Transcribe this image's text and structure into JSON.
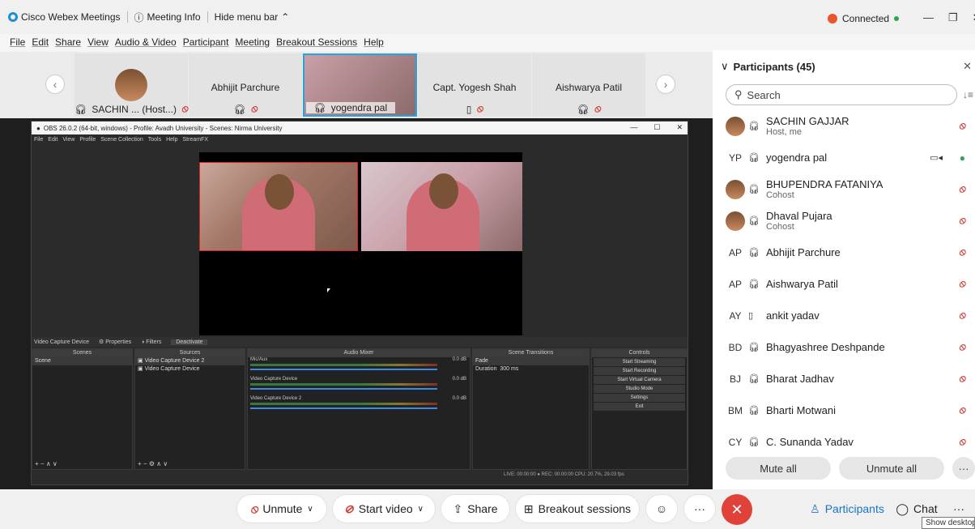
{
  "app": {
    "title": "Cisco Webex Meetings",
    "meeting_info": "Meeting Info",
    "hide_menu": "Hide menu bar",
    "connected": "Connected"
  },
  "menu": [
    "File",
    "Edit",
    "Share",
    "View",
    "Audio & Video",
    "Participant",
    "Meeting",
    "Breakout Sessions",
    "Help"
  ],
  "strip": {
    "tiles": [
      {
        "name": "SACHIN ... (Host...)"
      },
      {
        "name": "Abhijit Parchure"
      },
      {
        "name": "yogendra pal"
      },
      {
        "name": "Capt. Yogesh Shah"
      },
      {
        "name": "Aishwarya Patil"
      }
    ]
  },
  "obs": {
    "title": "OBS 26.0.2 (64-bit, windows) - Profile: Avadh University - Scenes: Nirma University",
    "menu": [
      "File",
      "Edit",
      "View",
      "Profile",
      "Scene Collection",
      "Tools",
      "Help",
      "StreamFX"
    ],
    "bar": {
      "source": "Video Capture Device",
      "properties": "Properties",
      "filters": "Filters",
      "deactivate": "Deactivate"
    },
    "scenes": {
      "header": "Scenes",
      "items": [
        "Scene"
      ]
    },
    "sources": {
      "header": "Sources",
      "items": [
        "Video Capture Device 2",
        "Video Capture Device"
      ]
    },
    "mixer": {
      "header": "Audio Mixer",
      "channels": [
        {
          "name": "Mic/Aux",
          "db": "0.0 dB"
        },
        {
          "name": "Video Capture Device",
          "db": "0.0 dB"
        },
        {
          "name": "Video Capture Device 2",
          "db": "0.0 dB"
        }
      ]
    },
    "transitions": {
      "header": "Scene Transitions",
      "type": "Fade",
      "duration_label": "Duration",
      "duration": "300 ms"
    },
    "controls": {
      "header": "Controls",
      "items": [
        "Start Streaming",
        "Start Recording",
        "Start Virtual Camera",
        "Studio Mode",
        "Settings",
        "Exit"
      ]
    },
    "status": "LIVE: 00:00:00  ● REC: 00:00:00   CPU: 20.7%, 29.03 fps"
  },
  "panel": {
    "title": "Participants (45)",
    "search_placeholder": "Search",
    "participants": [
      {
        "initials": "",
        "name": "SACHIN GAJJAR",
        "role": "Host, me",
        "photo": true
      },
      {
        "initials": "YP",
        "name": "yogendra pal",
        "role": "",
        "photo": false
      },
      {
        "initials": "",
        "name": "BHUPENDRA FATANIYA",
        "role": "Cohost",
        "photo": true
      },
      {
        "initials": "",
        "name": "Dhaval Pujara",
        "role": "Cohost",
        "photo": true
      },
      {
        "initials": "AP",
        "name": "Abhijit Parchure",
        "role": "",
        "photo": false
      },
      {
        "initials": "AP",
        "name": "Aishwarya Patil",
        "role": "",
        "photo": false
      },
      {
        "initials": "AY",
        "name": "ankit yadav",
        "role": "",
        "photo": false
      },
      {
        "initials": "BD",
        "name": "Bhagyashree Deshpande",
        "role": "",
        "photo": false
      },
      {
        "initials": "BJ",
        "name": "Bharat Jadhav",
        "role": "",
        "photo": false
      },
      {
        "initials": "BM",
        "name": "Bharti Motwani",
        "role": "",
        "photo": false
      },
      {
        "initials": "CY",
        "name": "C. Sunanda Yadav",
        "role": "",
        "photo": false
      }
    ],
    "mute_all": "Mute all",
    "unmute_all": "Unmute all"
  },
  "bottom": {
    "unmute": "Unmute",
    "start_video": "Start video",
    "share": "Share",
    "breakout": "Breakout sessions",
    "participants": "Participants",
    "chat": "Chat"
  },
  "tooltip": "Show desktop"
}
